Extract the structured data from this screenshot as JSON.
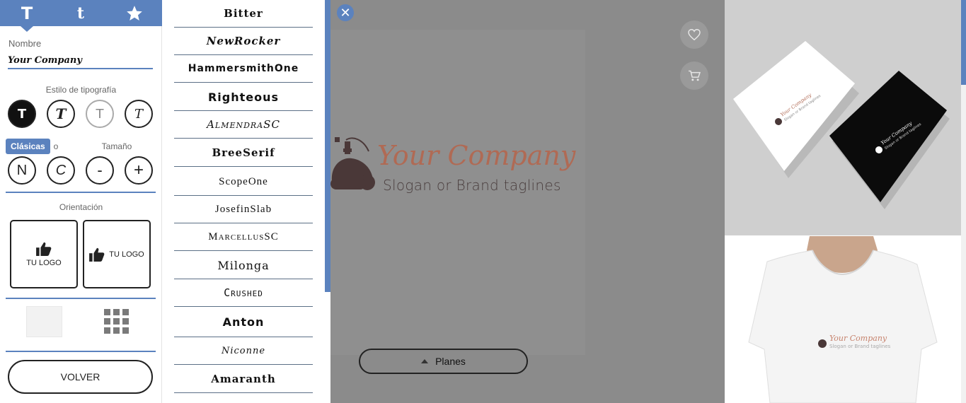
{
  "tabs": [
    {
      "label": "T",
      "icon": "text-bold-icon"
    },
    {
      "label": "t",
      "icon": "text-small-icon"
    },
    {
      "label": "",
      "icon": "star-icon"
    }
  ],
  "nombre": {
    "label": "Nombre",
    "value": "Your Company"
  },
  "estilo": {
    "title": "Estilo de tipografía",
    "options": [
      {
        "glyph": "T",
        "state": "active"
      },
      {
        "glyph": "T",
        "state": "script"
      },
      {
        "glyph": "T",
        "state": "light"
      },
      {
        "glyph": "T",
        "state": "italic"
      }
    ]
  },
  "formato": {
    "tooltip": "Clásicas",
    "hidden_label_tail": "o",
    "size_label": "Tamaño",
    "buttons": [
      "N",
      "C",
      "-",
      "+"
    ]
  },
  "orientacion": {
    "title": "Orientación",
    "vertical_label": "TU LOGO",
    "horizontal_label": "TU LOGO"
  },
  "volver_label": "VOLVER",
  "fonts": [
    "Bitter",
    "NewRocker",
    "HammersmithOne",
    "Righteous",
    "AlmendraSC",
    "BreeSerif",
    "ScopeOne",
    "JosefinSlab",
    "MarcellusSC",
    "Milonga",
    "Crushed",
    "Anton",
    "Niconne",
    "Amaranth"
  ],
  "preview": {
    "company": "Your Company",
    "slogan": "Slogan or Brand taglines",
    "planes_label": "Planes",
    "close_icon": "close-icon",
    "favorite_icon": "heart-icon",
    "cart_icon": "cart-icon"
  },
  "mockups": {
    "card_company": "Your Company",
    "card_slogan": "Slogan or Brand taglines",
    "shirt_company": "Your Company",
    "shirt_slogan": "Slogan or Brand taglines"
  },
  "colors": {
    "accent": "#5b82be",
    "brand_company": "#b06a54",
    "brand_icon": "#4a3838",
    "preview_bg": "#8b8b8b"
  }
}
